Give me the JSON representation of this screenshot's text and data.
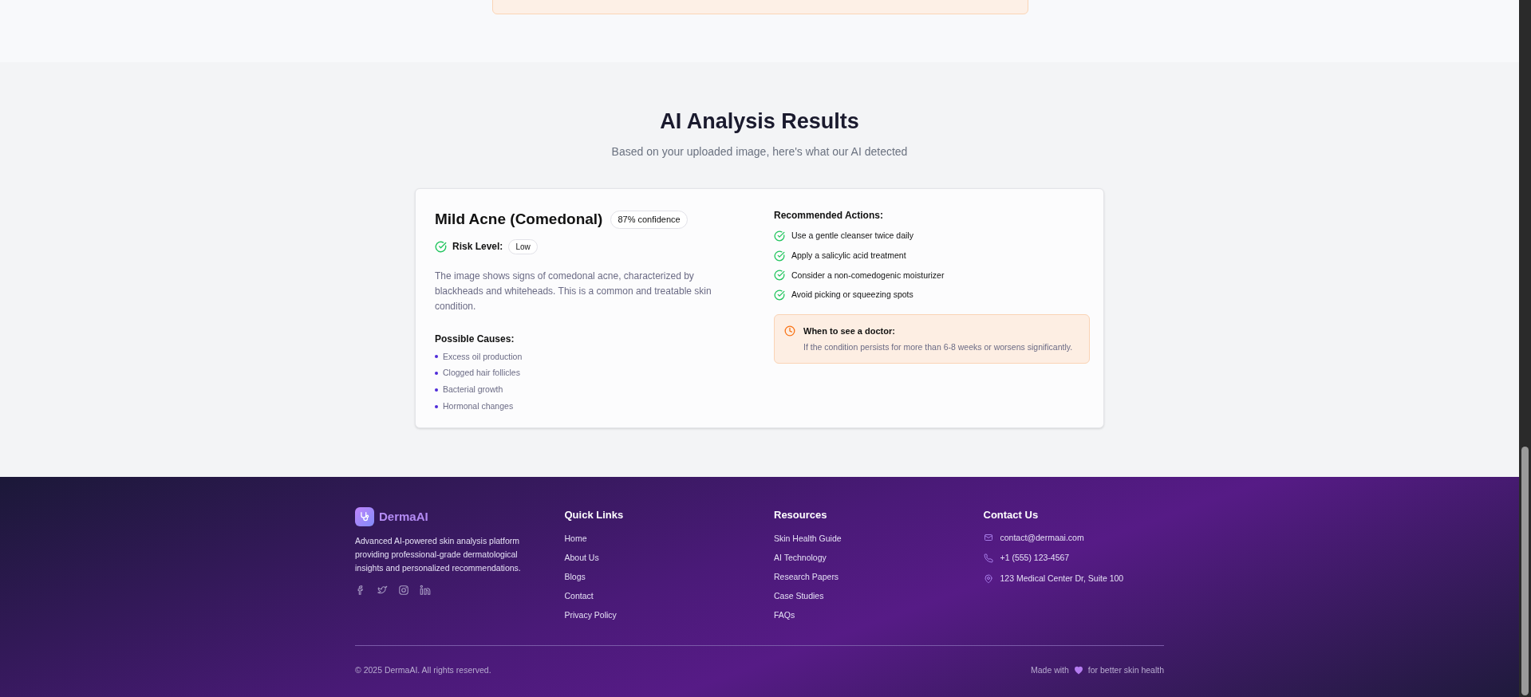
{
  "results": {
    "title": "AI Analysis Results",
    "subtitle": "Based on your uploaded image, here's what our AI detected",
    "condition": "Mild Acne (Comedonal)",
    "confidence": "87% confidence",
    "risk_label": "Risk Level:",
    "risk": "Low",
    "description": "The image shows signs of comedonal acne, characterized by blackheads and whiteheads. This is a common and treatable skin condition.",
    "causes_title": "Possible Causes:",
    "causes": [
      "Excess oil production",
      "Clogged hair follicles",
      "Bacterial growth",
      "Hormonal changes"
    ],
    "actions_title": "Recommended Actions:",
    "actions": [
      "Use a gentle cleanser twice daily",
      "Apply a salicylic acid treatment",
      "Consider a non-comedogenic moisturizer",
      "Avoid picking or squeezing spots"
    ],
    "doctor_title": "When to see a doctor:",
    "doctor_text": "If the condition persists for more than 6-8 weeks or worsens significantly."
  },
  "footer": {
    "brand": "DermaAI",
    "about": "Advanced AI-powered skin analysis platform providing professional-grade dermatological insights and personalized recommendations.",
    "socials": [
      {
        "kind": "facebook"
      },
      {
        "kind": "twitter"
      },
      {
        "kind": "instagram"
      },
      {
        "kind": "linkedin"
      }
    ],
    "columns": [
      {
        "title": "Quick Links",
        "links": [
          "Home",
          "About Us",
          "Blogs",
          "Contact",
          "Privacy Policy"
        ]
      },
      {
        "title": "Resources",
        "links": [
          "Skin Health Guide",
          "AI Technology",
          "Research Papers",
          "Case Studies",
          "FAQs"
        ]
      }
    ],
    "contact_title": "Contact Us",
    "contacts": [
      {
        "kind": "email",
        "text": "contact@dermaai.com"
      },
      {
        "kind": "phone",
        "text": "+1 (555) 123-4567"
      },
      {
        "kind": "address",
        "text": "123 Medical Center Dr, Suite 100"
      }
    ],
    "copyright": "© 2025 DermaAI. All rights reserved.",
    "made_with": "Made with",
    "made_for": "for better skin health"
  }
}
